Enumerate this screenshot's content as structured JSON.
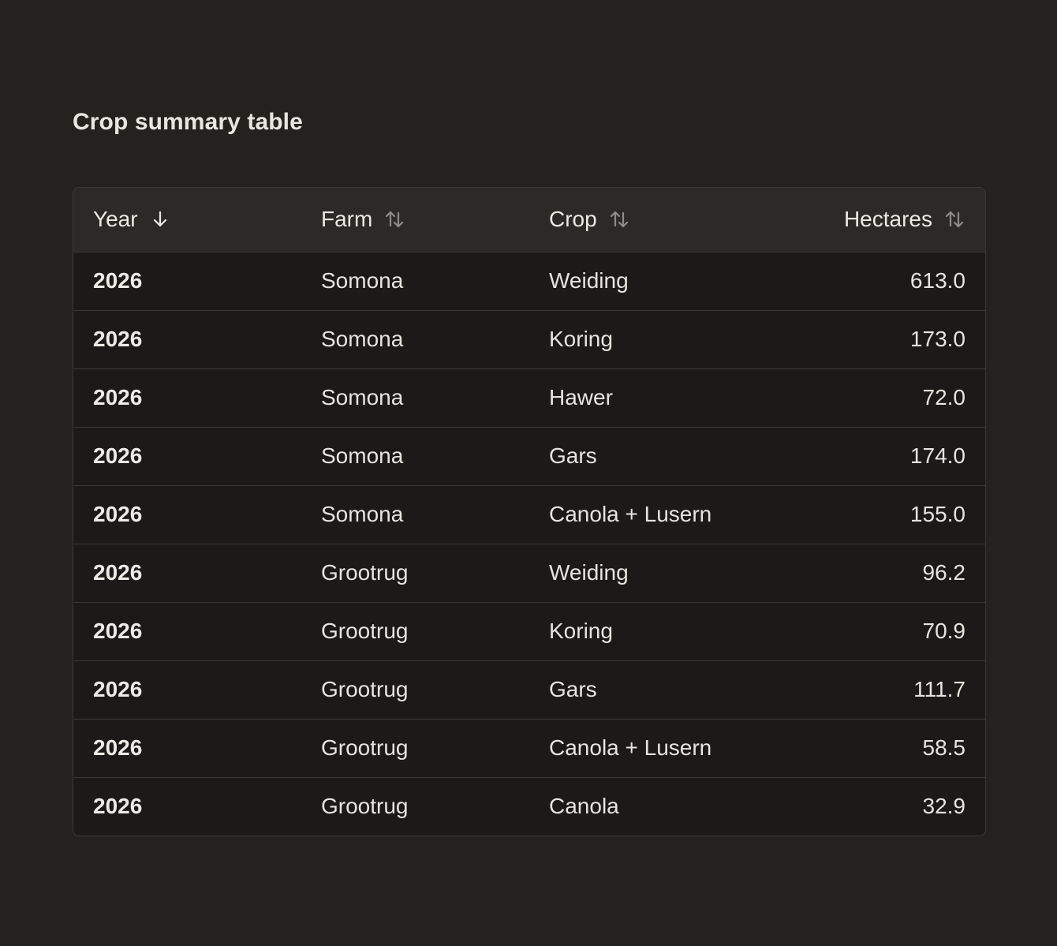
{
  "page": {
    "title": "Crop summary table"
  },
  "table": {
    "columns": [
      {
        "key": "year",
        "label": "Year",
        "sort": "descending",
        "sort_icon": "arrow-down-icon"
      },
      {
        "key": "farm",
        "label": "Farm",
        "sort": "none",
        "sort_icon": "sort-up-down-icon"
      },
      {
        "key": "crop",
        "label": "Crop",
        "sort": "none",
        "sort_icon": "sort-up-down-icon"
      },
      {
        "key": "hectares",
        "label": "Hectares",
        "sort": "none",
        "sort_icon": "sort-up-down-icon"
      }
    ],
    "rows": [
      {
        "year": "2026",
        "farm": "Somona",
        "crop": "Weiding",
        "hectares": "613.0"
      },
      {
        "year": "2026",
        "farm": "Somona",
        "crop": "Koring",
        "hectares": "173.0"
      },
      {
        "year": "2026",
        "farm": "Somona",
        "crop": "Hawer",
        "hectares": "72.0"
      },
      {
        "year": "2026",
        "farm": "Somona",
        "crop": "Gars",
        "hectares": "174.0"
      },
      {
        "year": "2026",
        "farm": "Somona",
        "crop": "Canola + Lusern",
        "hectares": "155.0"
      },
      {
        "year": "2026",
        "farm": "Grootrug",
        "crop": "Weiding",
        "hectares": "96.2"
      },
      {
        "year": "2026",
        "farm": "Grootrug",
        "crop": "Koring",
        "hectares": "70.9"
      },
      {
        "year": "2026",
        "farm": "Grootrug",
        "crop": "Gars",
        "hectares": "111.7"
      },
      {
        "year": "2026",
        "farm": "Grootrug",
        "crop": "Canola + Lusern",
        "hectares": "58.5"
      },
      {
        "year": "2026",
        "farm": "Grootrug",
        "crop": "Canola",
        "hectares": "32.9"
      }
    ]
  },
  "colors": {
    "background": "#23221f",
    "table_body": "#1b1a18",
    "table_header": "#2b2a27",
    "border": "#3a3935",
    "text": "#ebe9e4",
    "icon_active": "#ebe9e4",
    "icon_inactive": "#8f8d88"
  }
}
